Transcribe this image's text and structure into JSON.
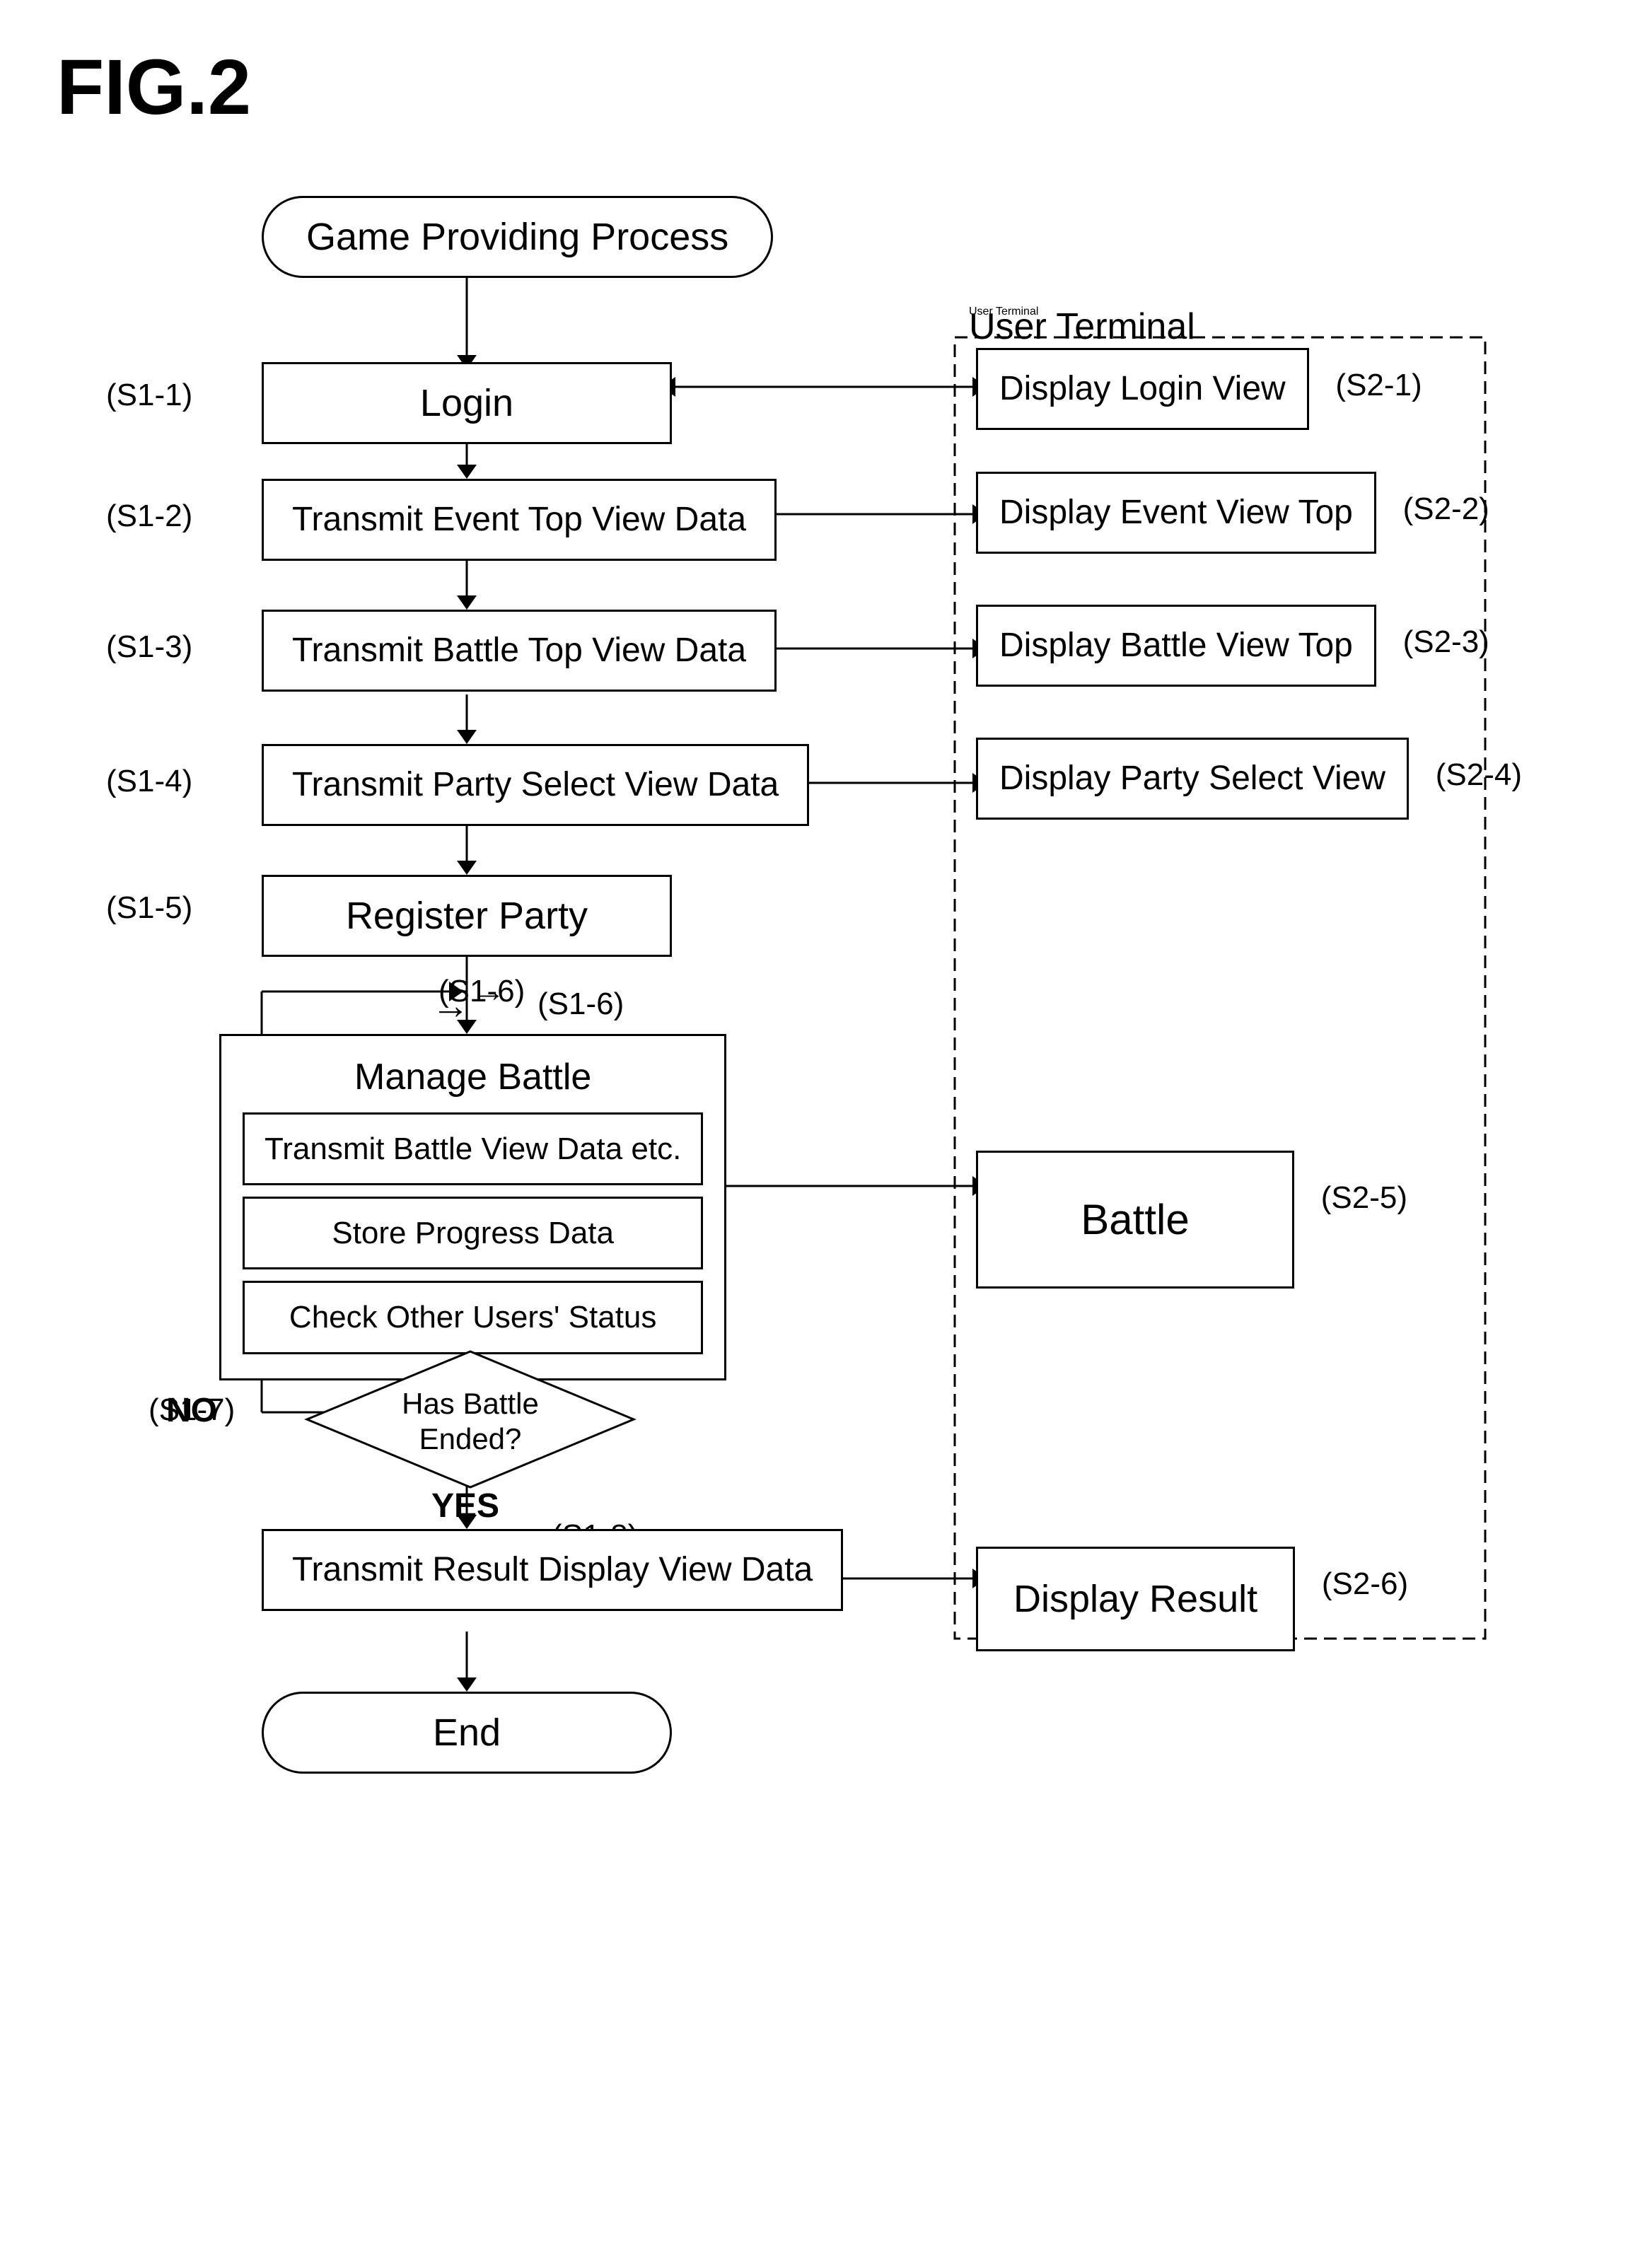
{
  "figure": {
    "title": "FIG.2"
  },
  "left": {
    "start_label": "Game Providing Process",
    "end_label": "End",
    "steps": [
      {
        "id": "s1-1",
        "label": "(S1-1)",
        "text": "Login"
      },
      {
        "id": "s1-2",
        "label": "(S1-2)",
        "text": "Transmit Event Top View Data"
      },
      {
        "id": "s1-3",
        "label": "(S1-3)",
        "text": "Transmit Battle Top View Data"
      },
      {
        "id": "s1-4",
        "label": "(S1-4)",
        "text": "Transmit Party Select View Data"
      },
      {
        "id": "s1-5",
        "label": "(S1-5)",
        "text": "Register Party"
      },
      {
        "id": "s1-6",
        "label": "(S1-6)",
        "text": "Manage Battle"
      },
      {
        "id": "s1-7",
        "label": "(S1-7)",
        "text": "Has Battle Ended?"
      },
      {
        "id": "s1-8",
        "label": "(S1-8)",
        "text": "Transmit Result Display View Data"
      }
    ],
    "manage_sub": {
      "title": "Manage Battle",
      "items": [
        "Transmit Battle View Data etc.",
        "Store Progress Data",
        "Check Other Users' Status"
      ]
    },
    "no_label": "NO",
    "yes_label": "YES"
  },
  "right": {
    "terminal_label": "User Terminal",
    "steps": [
      {
        "id": "s2-1",
        "label": "(S2-1)",
        "text": "Display Login View"
      },
      {
        "id": "s2-2",
        "label": "(S2-2)",
        "text": "Display Event View Top"
      },
      {
        "id": "s2-3",
        "label": "(S2-3)",
        "text": "Display Battle View Top"
      },
      {
        "id": "s2-4",
        "label": "(S2-4)",
        "text": "Display Party Select View"
      },
      {
        "id": "s2-5",
        "label": "(S2-5)",
        "text": "Battle"
      },
      {
        "id": "s2-6",
        "label": "(S2-6)",
        "text": "Display Result"
      }
    ]
  }
}
